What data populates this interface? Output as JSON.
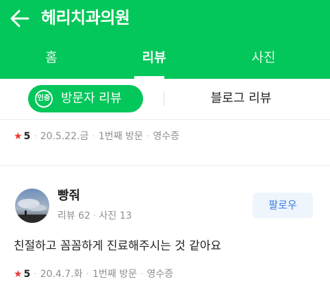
{
  "header": {
    "title": "헤리치과의원",
    "back_icon": "arrow-left-icon"
  },
  "tabs": [
    {
      "label": "홈",
      "active": false
    },
    {
      "label": "리뷰",
      "active": true
    },
    {
      "label": "사진",
      "active": false
    }
  ],
  "subtabs": {
    "visitor": {
      "badge": "인증",
      "label": "방문자 리뷰",
      "active": true
    },
    "blog": {
      "label": "블로그 리뷰",
      "active": false
    }
  },
  "reviews": [
    {
      "rating": "5",
      "date": "20.5.22.금",
      "visit": "1번째 방문",
      "receipt": "영수증"
    },
    {
      "author": "빵줘",
      "stats": {
        "reviews": "리뷰 62",
        "photos": "사진 13"
      },
      "follow_label": "팔로우",
      "text": "친절하고 꼼꼼하게 진료해주시는 것 같아요",
      "rating": "5",
      "date": "20.4.7.화",
      "visit": "1번째 방문",
      "receipt": "영수증"
    }
  ],
  "colors": {
    "brand": "#03c75a",
    "star": "#f1372f",
    "follow_text": "#3a7ce0",
    "follow_bg": "#eef5fd"
  }
}
